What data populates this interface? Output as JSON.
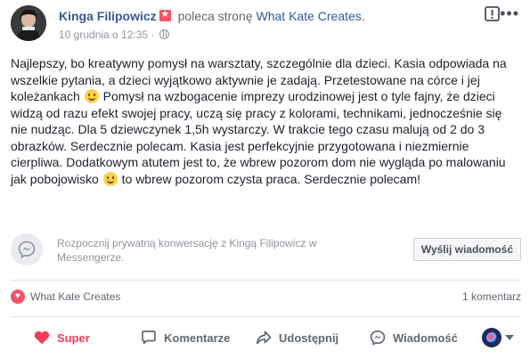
{
  "header": {
    "author_name": "Kinga Filipowicz",
    "recommends_text": "poleca stronę",
    "page_name": "What Kate Creates",
    "page_suffix": ".",
    "timestamp": "10 grudnia o 12:35",
    "separator": "·",
    "report_icon": "exclamation-square-icon",
    "more_icon": "more-dots-icon"
  },
  "post": {
    "segments": [
      "Najlepszy, bo kreatywny pomysł na warsztaty, szczególnie dla dzieci. Kasia odpowiada na wszelkie pytania, a dzieci wyjątkowo aktywnie je zadają. Przetestowane na córce i jej koleżankach",
      " Pomysł na wzbogacenie imprezy urodzinowej jest o tyle fajny, że dzieci widzą od razu efekt swojej pracy, uczą się pracy z kolorami, technikami, jednocześnie się nie nudząc. Dla 5 dziewczynek 1,5h wystarczy. W trakcie tego czasu malują od 2 do 3 obrazków. Serdecznie polecam. Kasia jest perfekcyjnie przygotowana i niezmiernie cierpliwa. Dodatkowym atutem jest to, że wbrew pozorom dom nie wygląda po malowaniu jak pobojowisko",
      " to wbrew pozorom czysta praca. Serdecznie polecam!"
    ]
  },
  "messenger": {
    "prompt": "Rozpocznij prywatną konwersację z Kingą Filipowicz w Messengerze.",
    "button_label": "Wyślij wiadomość"
  },
  "stats": {
    "reaction_name": "What Kate Creates",
    "comment_count": "1 komentarz"
  },
  "actions": {
    "like_label": "Super",
    "comment_label": "Komentarze",
    "share_label": "Udostępnij",
    "message_label": "Wiadomość"
  },
  "colors": {
    "link": "#385898",
    "like_active": "#f33e58",
    "muted": "#90949c"
  }
}
